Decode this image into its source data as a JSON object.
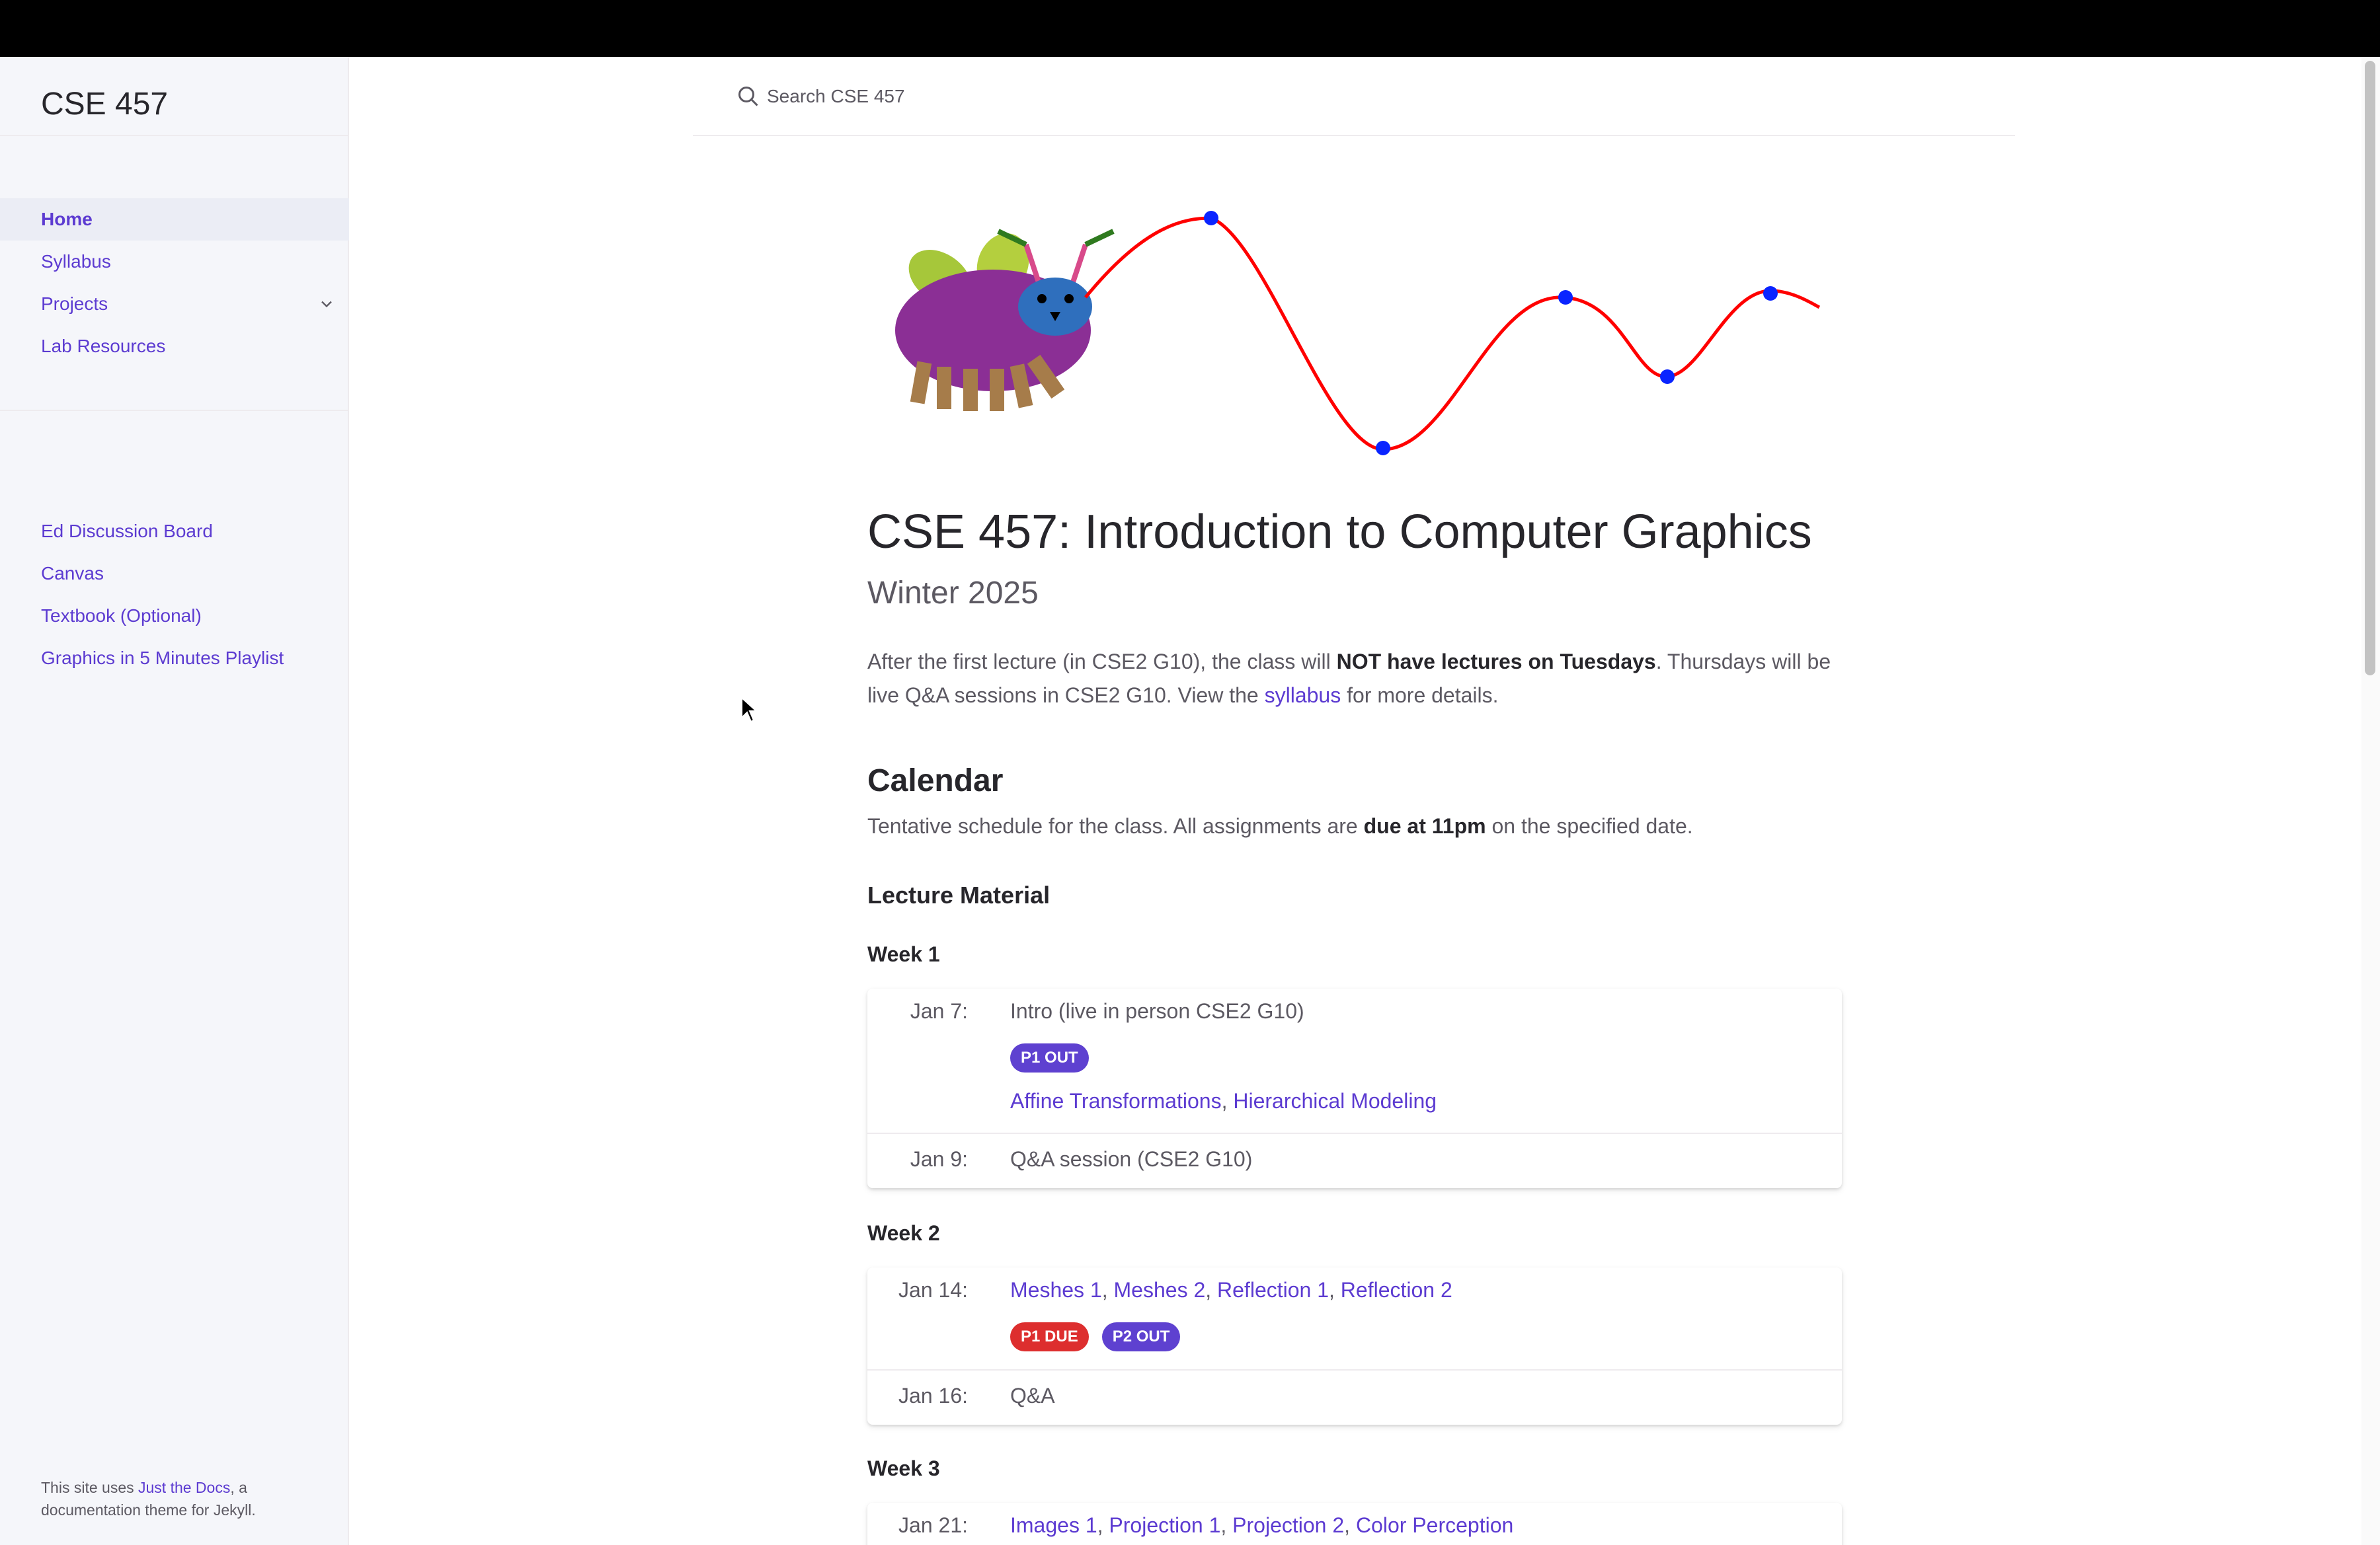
{
  "site": {
    "title": "CSE 457"
  },
  "sidebar": {
    "nav": [
      {
        "label": "Home",
        "active": true
      },
      {
        "label": "Syllabus"
      },
      {
        "label": "Projects",
        "expandable": true
      },
      {
        "label": "Lab Resources"
      }
    ],
    "external": [
      {
        "label": "Ed Discussion Board"
      },
      {
        "label": "Canvas"
      },
      {
        "label": "Textbook (Optional)"
      },
      {
        "label": "Graphics in 5 Minutes Playlist"
      }
    ],
    "footer": {
      "prefix": "This site uses ",
      "link": "Just the Docs",
      "suffix": ", a documentation theme for Jekyll."
    }
  },
  "search": {
    "placeholder": "Search CSE 457"
  },
  "page": {
    "title": "CSE 457: Introduction to Computer Graphics",
    "subtitle": "Winter 2025",
    "intro": {
      "p1": "After the first lecture (in CSE2 G10), the class will ",
      "bold": "NOT have lectures on Tuesdays",
      "p2": ". Thursdays will be live Q&A sessions in CSE2 G10. View the ",
      "link": "syllabus",
      "p3": " for more details."
    }
  },
  "calendar": {
    "heading": "Calendar",
    "desc_pre": "Tentative schedule for the class. All assignments are ",
    "desc_bold": "due at 11pm",
    "desc_post": " on the specified date.",
    "section": "Lecture Material",
    "weeks": [
      {
        "title": "Week 1",
        "rows": [
          {
            "date": "Jan 7:",
            "text": "Intro (live in person CSE2 G10)",
            "badges": [
              "P1 OUT"
            ],
            "links": [
              "Affine Transformations",
              "Hierarchical Modeling"
            ]
          },
          {
            "date": "Jan 9:",
            "text": "Q&A session (CSE2 G10)"
          }
        ]
      },
      {
        "title": "Week 2",
        "rows": [
          {
            "date": "Jan 14:",
            "links": [
              "Meshes 1",
              "Meshes 2",
              "Reflection 1",
              "Reflection 2"
            ],
            "badges": [
              "P1 DUE",
              "P2 OUT"
            ]
          },
          {
            "date": "Jan 16:",
            "text": "Q&A"
          }
        ]
      },
      {
        "title": "Week 3",
        "rows": [
          {
            "date": "Jan 21:",
            "links": [
              "Images 1",
              "Projection 1",
              "Projection 2",
              "Color Perception"
            ]
          }
        ]
      }
    ]
  },
  "colors": {
    "link": "#5c3bd1",
    "badge_out": "#5e41d0",
    "badge_due": "#dd2e2e",
    "curve": "#ff0000",
    "points": "#0a24ff"
  }
}
